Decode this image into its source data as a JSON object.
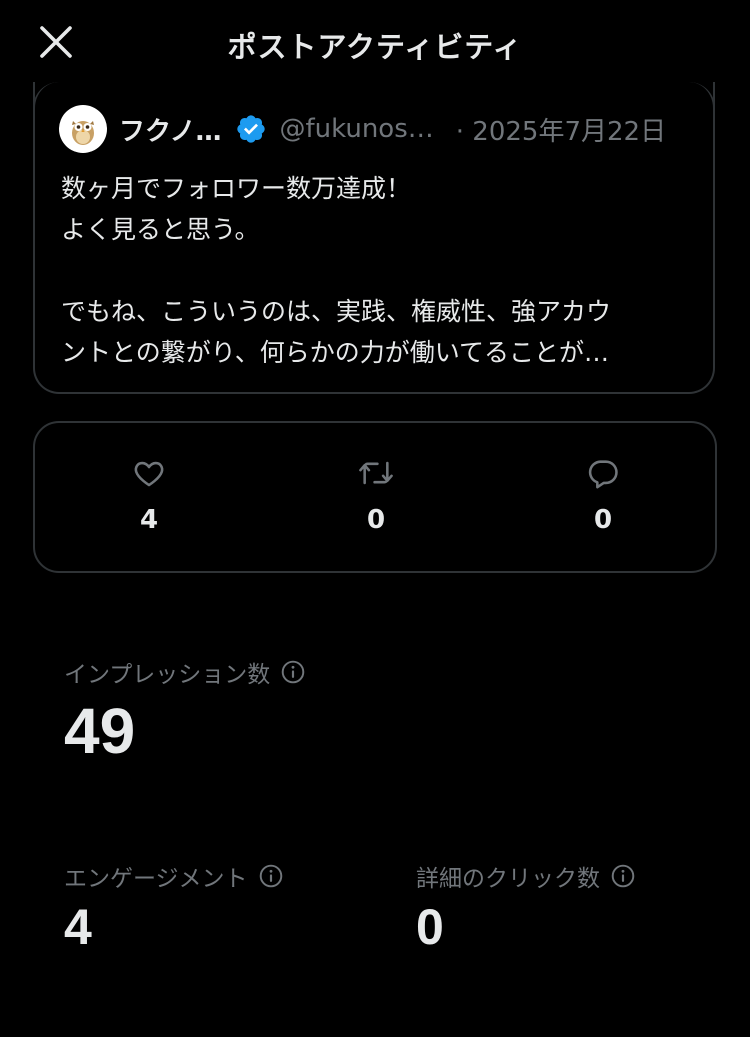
{
  "header": {
    "title": "ポストアクティビティ",
    "close_icon": "close-icon"
  },
  "post": {
    "author_name": "フクノ…",
    "verified_icon": "verified-badge-icon",
    "handle": "@fukunos…",
    "date": "· 2025年7月22日",
    "text": "数ヶ月でフォロワー数万達成！\nよく見ると思う。\n\nでもね、こういうのは、実践、権威性、強アカウ\nントとの繋がり、何らかの力が働いてることが…"
  },
  "stats": {
    "likes": "4",
    "reposts": "0",
    "replies": "0"
  },
  "metrics": {
    "impressions_label": "インプレッション数",
    "impressions_value": "49",
    "engagement_label": "エンゲージメント",
    "engagement_value": "4",
    "detail_clicks_label": "詳細のクリック数",
    "detail_clicks_value": "0"
  },
  "colors": {
    "background": "#000000",
    "text_primary": "#e7e9ea",
    "text_secondary": "#71767b",
    "border": "#2f3336",
    "verified": "#1d9bf0"
  }
}
